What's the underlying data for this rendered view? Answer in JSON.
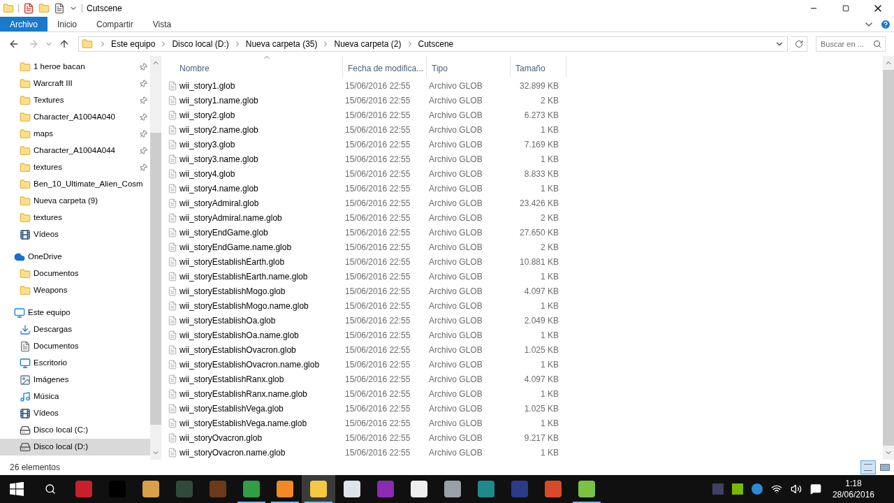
{
  "window": {
    "title": "Cutscene"
  },
  "ribbon_tabs": [
    {
      "label": "Archivo",
      "selected": true
    },
    {
      "label": "Inicio",
      "selected": false
    },
    {
      "label": "Compartir",
      "selected": false
    },
    {
      "label": "Vista",
      "selected": false
    }
  ],
  "address": {
    "crumbs": [
      "Este equipo",
      "Disco local (D:)",
      "Nueva carpeta (35)",
      "Nueva carpeta (2)",
      "Cutscene"
    ]
  },
  "search": {
    "placeholder": "Buscar en ..."
  },
  "sidebar": {
    "items": [
      {
        "label": "1 heroe bacan",
        "kind": "folder",
        "pinned": true,
        "selected": false
      },
      {
        "label": "Warcraft III",
        "kind": "folder",
        "pinned": true,
        "selected": false
      },
      {
        "label": "Textures",
        "kind": "folder",
        "pinned": true,
        "selected": false
      },
      {
        "label": "Character_A1004A040",
        "kind": "folder",
        "pinned": true,
        "selected": false
      },
      {
        "label": "maps",
        "kind": "folder",
        "pinned": true,
        "selected": false
      },
      {
        "label": "Character_A1004A044",
        "kind": "folder",
        "pinned": true,
        "selected": false
      },
      {
        "label": "textures",
        "kind": "folder",
        "pinned": true,
        "selected": false
      },
      {
        "label": "Ben_10_Ultimate_Alien_Cosm",
        "kind": "folder",
        "pinned": false,
        "selected": false
      },
      {
        "label": "Nueva carpeta (9)",
        "kind": "folder",
        "pinned": false,
        "selected": false
      },
      {
        "label": "textures",
        "kind": "folder",
        "pinned": false,
        "selected": false
      },
      {
        "label": "Vídeos",
        "kind": "video",
        "pinned": false,
        "selected": false
      },
      {
        "label": "OneDrive",
        "kind": "cloud",
        "pinned": false,
        "selected": false,
        "children": [
          {
            "label": "Documentos",
            "kind": "folder",
            "pinned": false,
            "selected": false
          },
          {
            "label": "Weapons",
            "kind": "folder",
            "pinned": false,
            "selected": false
          }
        ]
      },
      {
        "label": "Este equipo",
        "kind": "pc",
        "pinned": false,
        "selected": false,
        "children": [
          {
            "label": "Descargas",
            "kind": "download",
            "pinned": false,
            "selected": false
          },
          {
            "label": "Documentos",
            "kind": "document",
            "pinned": false,
            "selected": false
          },
          {
            "label": "Escritorio",
            "kind": "desktop",
            "pinned": false,
            "selected": false
          },
          {
            "label": "Imágenes",
            "kind": "pictures",
            "pinned": false,
            "selected": false
          },
          {
            "label": "Música",
            "kind": "music",
            "pinned": false,
            "selected": false
          },
          {
            "label": "Vídeos",
            "kind": "video",
            "pinned": false,
            "selected": false
          },
          {
            "label": "Disco local (C:)",
            "kind": "drive",
            "pinned": false,
            "selected": false
          },
          {
            "label": "Disco local (D:)",
            "kind": "drive",
            "pinned": false,
            "selected": true
          }
        ]
      }
    ]
  },
  "table": {
    "columns": [
      "Nombre",
      "Fecha de modifica...",
      "Tipo",
      "Tamaño"
    ],
    "rows": [
      [
        "wii_story1.glob",
        "15/06/2016 22:55",
        "Archivo GLOB",
        "32.899 KB"
      ],
      [
        "wii_story1.name.glob",
        "15/06/2016 22:55",
        "Archivo GLOB",
        "2 KB"
      ],
      [
        "wii_story2.glob",
        "15/06/2016 22:55",
        "Archivo GLOB",
        "6.273 KB"
      ],
      [
        "wii_story2.name.glob",
        "15/06/2016 22:55",
        "Archivo GLOB",
        "1 KB"
      ],
      [
        "wii_story3.glob",
        "15/06/2016 22:55",
        "Archivo GLOB",
        "7.169 KB"
      ],
      [
        "wii_story3.name.glob",
        "15/06/2016 22:55",
        "Archivo GLOB",
        "1 KB"
      ],
      [
        "wii_story4.glob",
        "15/06/2016 22:55",
        "Archivo GLOB",
        "8.833 KB"
      ],
      [
        "wii_story4.name.glob",
        "15/06/2016 22:55",
        "Archivo GLOB",
        "1 KB"
      ],
      [
        "wii_storyAdmiral.glob",
        "15/06/2016 22:55",
        "Archivo GLOB",
        "23.426 KB"
      ],
      [
        "wii_storyAdmiral.name.glob",
        "15/06/2016 22:55",
        "Archivo GLOB",
        "2 KB"
      ],
      [
        "wii_storyEndGame.glob",
        "15/06/2016 22:55",
        "Archivo GLOB",
        "27.650 KB"
      ],
      [
        "wii_storyEndGame.name.glob",
        "15/06/2016 22:55",
        "Archivo GLOB",
        "2 KB"
      ],
      [
        "wii_storyEstablishEarth.glob",
        "15/06/2016 22:55",
        "Archivo GLOB",
        "10.881 KB"
      ],
      [
        "wii_storyEstablishEarth.name.glob",
        "15/06/2016 22:55",
        "Archivo GLOB",
        "1 KB"
      ],
      [
        "wii_storyEstablishMogo.glob",
        "15/06/2016 22:55",
        "Archivo GLOB",
        "4.097 KB"
      ],
      [
        "wii_storyEstablishMogo.name.glob",
        "15/06/2016 22:55",
        "Archivo GLOB",
        "1 KB"
      ],
      [
        "wii_storyEstablishOa.glob",
        "15/06/2016 22:55",
        "Archivo GLOB",
        "2.049 KB"
      ],
      [
        "wii_storyEstablishOa.name.glob",
        "15/06/2016 22:55",
        "Archivo GLOB",
        "1 KB"
      ],
      [
        "wii_storyEstablishOvacron.glob",
        "15/06/2016 22:55",
        "Archivo GLOB",
        "1.025 KB"
      ],
      [
        "wii_storyEstablishOvacron.name.glob",
        "15/06/2016 22:55",
        "Archivo GLOB",
        "1 KB"
      ],
      [
        "wii_storyEstablishRanx.glob",
        "15/06/2016 22:55",
        "Archivo GLOB",
        "4.097 KB"
      ],
      [
        "wii_storyEstablishRanx.name.glob",
        "15/06/2016 22:55",
        "Archivo GLOB",
        "1 KB"
      ],
      [
        "wii_storyEstablishVega.glob",
        "15/06/2016 22:55",
        "Archivo GLOB",
        "1.025 KB"
      ],
      [
        "wii_storyEstablishVega.name.glob",
        "15/06/2016 22:55",
        "Archivo GLOB",
        "1 KB"
      ],
      [
        "wii_storyOvacron.glob",
        "15/06/2016 22:55",
        "Archivo GLOB",
        "9.217 KB"
      ],
      [
        "wii_storyOvacron.name.glob",
        "15/06/2016 22:55",
        "Archivo GLOB",
        "1 KB"
      ]
    ]
  },
  "status_bar": {
    "count": "26 elementos"
  },
  "taskbar": {
    "apps": [
      {
        "color": "#c8202a",
        "running": false,
        "active": false
      },
      {
        "color": "#000000",
        "running": false,
        "active": false
      },
      {
        "color": "#d9a04a",
        "running": false,
        "active": false
      },
      {
        "color": "#2f4a3a",
        "running": false,
        "active": false
      },
      {
        "color": "#6a3a1a",
        "running": false,
        "active": false
      },
      {
        "color": "#2f9e44",
        "running": true,
        "active": false
      },
      {
        "color": "#f08a24",
        "running": true,
        "active": false
      },
      {
        "color": "#f5c842",
        "running": true,
        "active": true
      },
      {
        "color": "#dde3ea",
        "running": false,
        "active": false
      },
      {
        "color": "#8a2bb0",
        "running": false,
        "active": false
      },
      {
        "color": "#eeeeee",
        "running": false,
        "active": false
      },
      {
        "color": "#9aa0a8",
        "running": false,
        "active": false
      },
      {
        "color": "#1f8a8a",
        "running": false,
        "active": false
      },
      {
        "color": "#2c3a8a",
        "running": false,
        "active": false
      },
      {
        "color": "#d94a2a",
        "running": false,
        "active": false
      },
      {
        "color": "#7cc242",
        "running": true,
        "active": false
      }
    ],
    "time": "1:18",
    "date": "28/06/2016"
  }
}
